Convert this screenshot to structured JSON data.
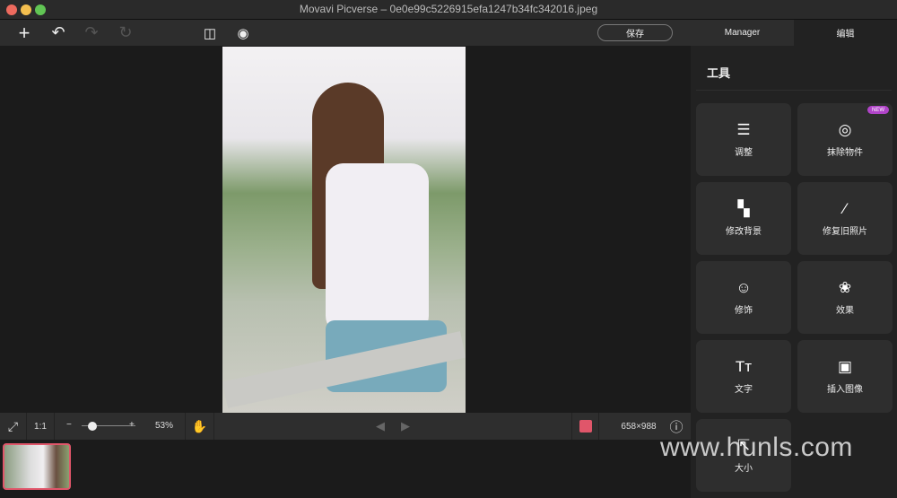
{
  "window": {
    "title": "Movavi Picverse – 0e0e99c5226915efa1247b34fc342016.jpeg"
  },
  "toolbar": {
    "save_label": "保存",
    "tabs": [
      {
        "label": "Manager"
      },
      {
        "label": "编辑"
      }
    ]
  },
  "panel": {
    "title": "工具",
    "new_badge": "NEW",
    "tools": [
      {
        "label": "调整",
        "icon": "sliders-icon"
      },
      {
        "label": "抹除物件",
        "icon": "eraser-target-icon"
      },
      {
        "label": "修改背景",
        "icon": "background-icon"
      },
      {
        "label": "修复旧照片",
        "icon": "magic-wand-icon"
      },
      {
        "label": "修饰",
        "icon": "smile-icon"
      },
      {
        "label": "效果",
        "icon": "effects-icon"
      },
      {
        "label": "文字",
        "icon": "text-icon"
      },
      {
        "label": "插入图像",
        "icon": "insert-image-icon"
      },
      {
        "label": "大小",
        "icon": "resize-icon"
      }
    ]
  },
  "bottombar": {
    "ratio": "1:1",
    "minus": "−",
    "plus": "+",
    "zoom": "53%",
    "zoom_fraction": 0.2,
    "dimensions": "658×988"
  },
  "watermark": "www.hunls.com",
  "colors": {
    "accent": "#e0566a",
    "badge": "#b144c9"
  }
}
